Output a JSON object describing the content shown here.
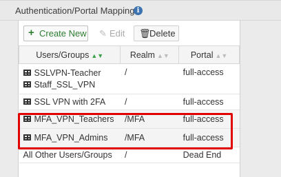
{
  "section": {
    "title": "Authentication/Portal Mapping",
    "info_icon": "info-icon"
  },
  "toolbar": {
    "create_label": "Create New",
    "edit_label": "Edit",
    "delete_label": "Delete"
  },
  "table": {
    "headers": [
      "Users/Groups",
      "Realm",
      "Portal"
    ],
    "rows": [
      {
        "groups": [
          "SSLVPN-Teacher",
          "Staff_SSL_VPN"
        ],
        "realm": "/",
        "portal": "full-access"
      },
      {
        "groups": [
          "SSL VPN with 2FA"
        ],
        "realm": "/",
        "portal": "full-access"
      },
      {
        "groups": [
          "MFA_VPN_Teachers"
        ],
        "realm": "/MFA",
        "portal": "full-access"
      },
      {
        "groups": [
          "MFA_VPN_Admins"
        ],
        "realm": "/MFA",
        "portal": "full-access"
      },
      {
        "groups": [
          "All Other Users/Groups"
        ],
        "realm": "/",
        "portal": "Dead End"
      }
    ]
  },
  "colors": {
    "highlight_border": "#e10000",
    "create_accent": "#2e7d32"
  }
}
